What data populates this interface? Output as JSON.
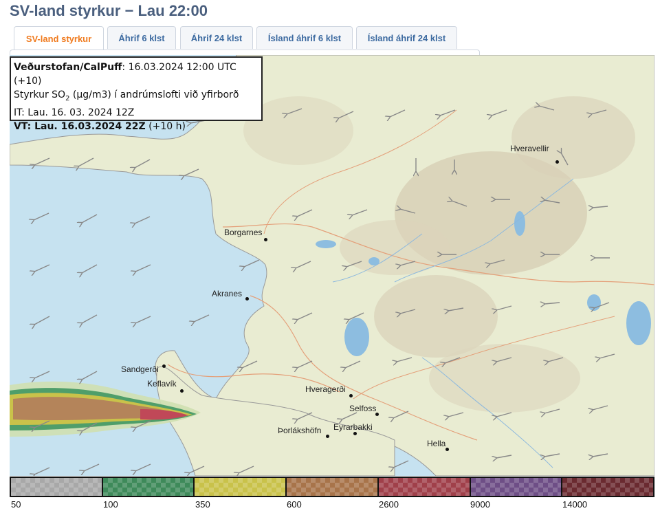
{
  "page_title": "SV-land styrkur − Lau 22:00",
  "tabs": [
    {
      "label": "SV-land styrkur",
      "active": true
    },
    {
      "label": "Áhrif 6 klst",
      "active": false
    },
    {
      "label": "Áhrif 24 klst",
      "active": false
    },
    {
      "label": "Ísland áhrif 6 klst",
      "active": false
    },
    {
      "label": "Ísland áhrif 24 klst",
      "active": false
    }
  ],
  "infobox": {
    "source_label": "Veðurstofan/CalPuff",
    "source_time": ": 16.03.2024 12:00 UTC (+10)",
    "line2_pre": "Styrkur SO",
    "line2_sub": "2",
    "line2_post": " (µg/m3) í andrúmslofti við yfirborð",
    "line3": "IT: Lau. 16. 03. 2024 12Z",
    "line4_bold": "VT: Lau. 16.03.2024 22Z",
    "line4_rest": " (+10 h)"
  },
  "places": [
    {
      "name": "Hveravellir"
    },
    {
      "name": "Borgarnes"
    },
    {
      "name": "Akranes"
    },
    {
      "name": "Sandgerði"
    },
    {
      "name": "Keflavík"
    },
    {
      "name": "Hveragerði"
    },
    {
      "name": "Selfoss"
    },
    {
      "name": "Þorlákshöfn"
    },
    {
      "name": "Eyrarbakki"
    },
    {
      "name": "Hella"
    }
  ],
  "legend": {
    "labels": [
      "50",
      "100",
      "350",
      "600",
      "2600",
      "9000",
      "14000"
    ],
    "colors": [
      "#a8a8a8",
      "#3e8a5a",
      "#c9c24a",
      "#a8744a",
      "#a0404a",
      "#6e4e86",
      "#6a2a30"
    ]
  },
  "colors": {
    "accent": "#f07b1f",
    "tab_text": "#3c6aa0",
    "title": "#4a5f7e",
    "sea": "#c6e2f0",
    "land": "#e9ecd2"
  }
}
